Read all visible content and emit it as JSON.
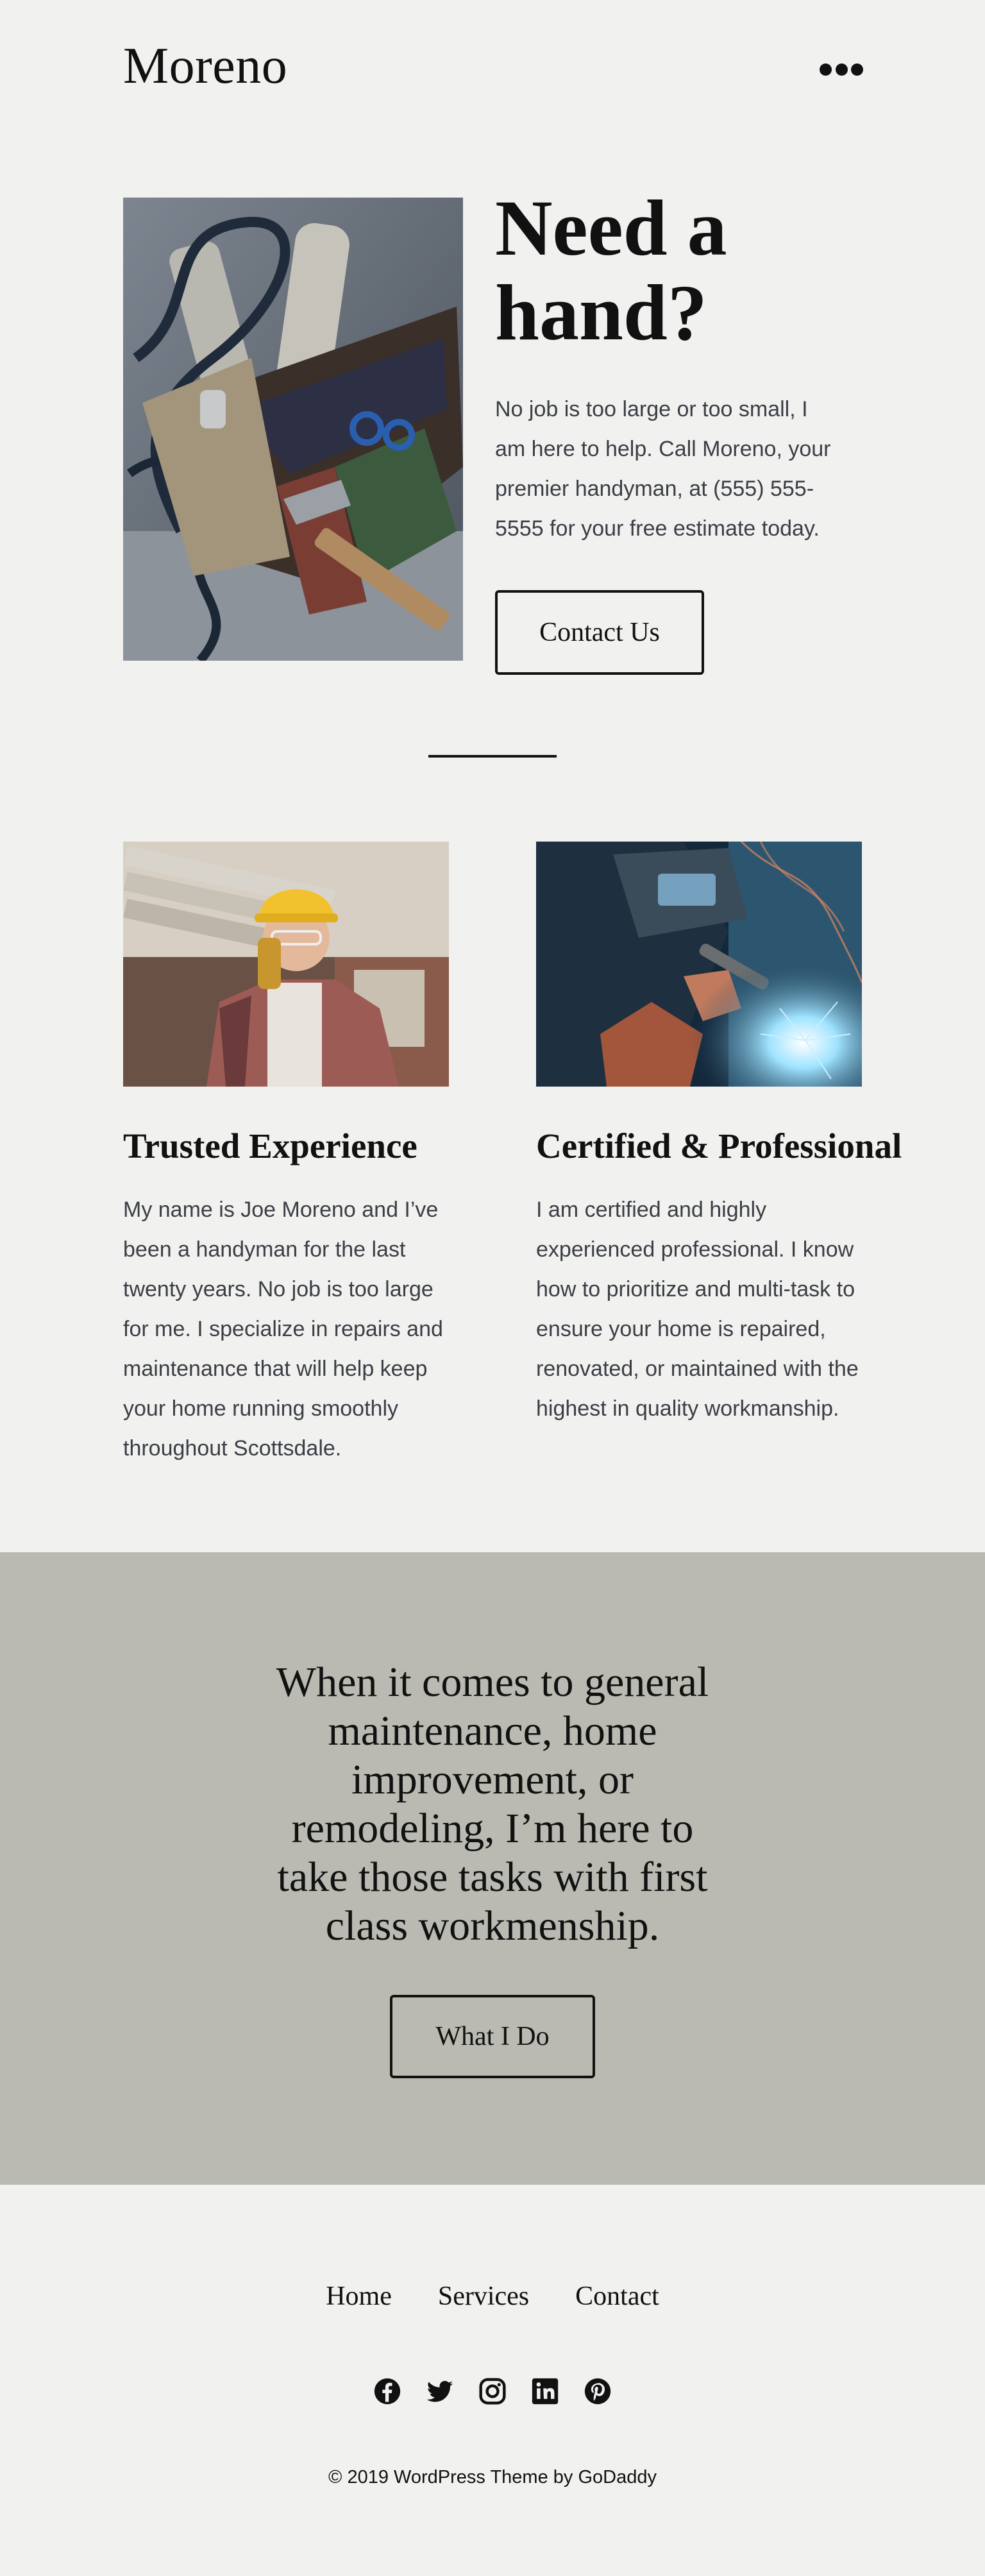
{
  "site": {
    "title": "Moreno"
  },
  "header": {
    "menu_icon": "more-dots-icon"
  },
  "hero": {
    "heading": "Need a hand?",
    "text": "No job is too large or too small, I am here to help. Call Moreno, your premier handyman, at (555) 555-5555 for your free estimate today.",
    "button": "Contact Us",
    "image": "tool-belt-image"
  },
  "features": [
    {
      "title": "Trusted Experience",
      "text": "My name is Joe Moreno and I’ve been a handyman for the last twenty years. No job is too large for me. I specialize in repairs and maintenance that will help keep your home running smoothly throughout Scottsdale.",
      "image": "worker-with-hardhat-image"
    },
    {
      "title": "Certified & Professional",
      "text": "I am certified and highly experienced professional. I know how to prioritize and multi-task to ensure your home is repaired, renovated, or maintained with the highest in quality workmanship.",
      "image": "welder-image"
    }
  ],
  "band": {
    "text": "When it comes to general maintenance, home improvement, or remodeling, I’m here to take those tasks with first class workmenship.",
    "button": "What I Do"
  },
  "footer": {
    "nav": [
      "Home",
      "Services",
      "Contact"
    ],
    "social_icons": [
      "facebook-icon",
      "twitter-icon",
      "instagram-icon",
      "linkedin-icon",
      "pinterest-icon"
    ],
    "copyright": "© 2019  WordPress Theme by GoDaddy"
  },
  "colors": {
    "page_background": "#f1f1ef",
    "band_background": "#babab2",
    "text": "#141414",
    "body_text": "#3a3e45"
  }
}
